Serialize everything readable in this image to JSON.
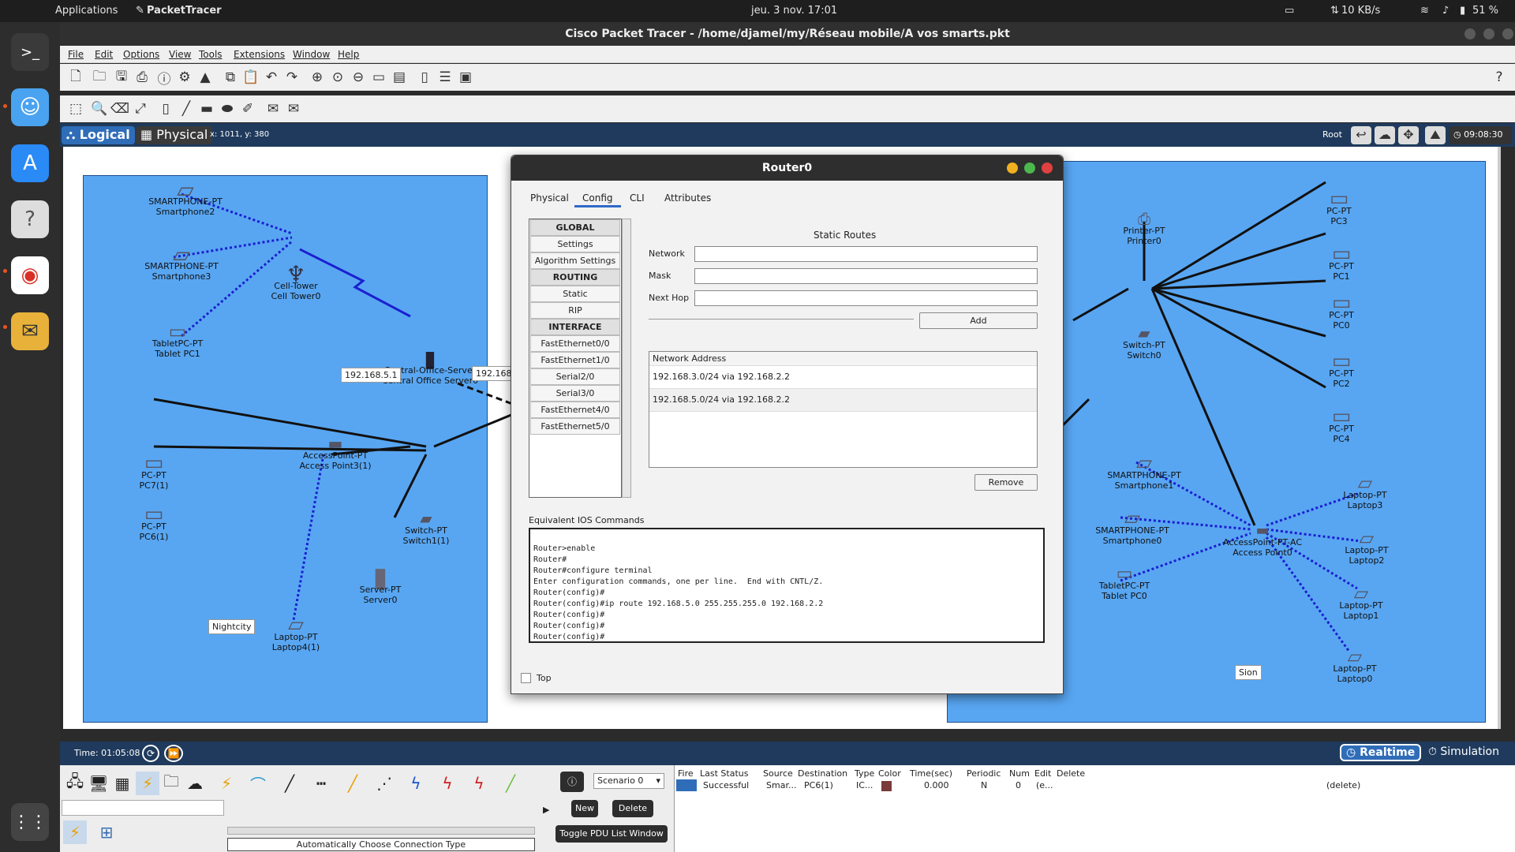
{
  "topbar": {
    "apps": "Applications",
    "active_app": "PacketTracer",
    "clock": "jeu. 3 nov.  17:01",
    "network": "10 KB/s",
    "battery": "51 %"
  },
  "window": {
    "title": "Cisco Packet Tracer - /home/djamel/my/Réseau mobile/A vos smarts.pkt"
  },
  "menu": [
    "File",
    "Edit",
    "Options",
    "View",
    "Tools",
    "Extensions",
    "Window",
    "Help"
  ],
  "logicbar": {
    "logical": "Logical",
    "physical": "Physical",
    "coords": "x: 1011, y: 380",
    "root": "Root",
    "time": "09:08:30"
  },
  "devices": {
    "smartphone2": [
      "SMARTPHONE-PT",
      "Smartphone2"
    ],
    "smartphone3": [
      "SMARTPHONE-PT",
      "Smartphone3"
    ],
    "celltower": [
      "Cell-Tower",
      "Cell Tower0"
    ],
    "tablet1": [
      "TabletPC-PT",
      "Tablet PC1"
    ],
    "co_server": [
      "Central-Office-Server",
      "Central Office Server0"
    ],
    "accesspoint3": [
      "AccessPoint-PT",
      "Access Point3(1)"
    ],
    "pc7": [
      "PC-PT",
      "PC7(1)"
    ],
    "pc6": [
      "PC-PT",
      "PC6(1)"
    ],
    "switch1": [
      "Switch-PT",
      "Switch1(1)"
    ],
    "server0": [
      "Server-PT",
      "Server0"
    ],
    "laptop4": [
      "Laptop-PT",
      "Laptop4(1)"
    ],
    "printer0": [
      "Printer-PT",
      "Printer0"
    ],
    "pc3": [
      "PC-PT",
      "PC3"
    ],
    "pc1": [
      "PC-PT",
      "PC1"
    ],
    "pc0": [
      "PC-PT",
      "PC0"
    ],
    "pc2": [
      "PC-PT",
      "PC2"
    ],
    "pc4": [
      "PC-PT",
      "PC4"
    ],
    "switch0": [
      "Switch-PT",
      "Switch0"
    ],
    "smartphone1": [
      "SMARTPHONE-PT",
      "Smartphone1"
    ],
    "smartphone0": [
      "SMARTPHONE-PT",
      "Smartphone0"
    ],
    "tablet0": [
      "TabletPC-PT",
      "Tablet PC0"
    ],
    "accesspoint0": [
      "AccessPoint-PT-AC",
      "Access Point0"
    ],
    "laptop3": [
      "Laptop-PT",
      "Laptop3"
    ],
    "laptop2": [
      "Laptop-PT",
      "Laptop2"
    ],
    "laptop1": [
      "Laptop-PT",
      "Laptop1"
    ],
    "laptop0": [
      "Laptop-PT",
      "Laptop0"
    ]
  },
  "labels": {
    "ip1": "192.168.5.1",
    "ip2": "192.168",
    "nightcity": "Nightcity",
    "sion": "Sion"
  },
  "dialog": {
    "title": "Router0",
    "tabs": [
      "Physical",
      "Config",
      "CLI",
      "Attributes"
    ],
    "nav": [
      "GLOBAL",
      "Settings",
      "Algorithm Settings",
      "ROUTING",
      "Static",
      "RIP",
      "INTERFACE",
      "FastEthernet0/0",
      "FastEthernet1/0",
      "Serial2/0",
      "Serial3/0",
      "FastEthernet4/0",
      "FastEthernet5/0"
    ],
    "section_title": "Static Routes",
    "network_label": "Network",
    "mask_label": "Mask",
    "nexthop_label": "Next Hop",
    "add_label": "Add",
    "table_header": "Network Address",
    "routes": [
      "192.168.3.0/24 via 192.168.2.2",
      "192.168.5.0/24 via 192.168.2.2"
    ],
    "remove_label": "Remove",
    "ios_label": "Equivalent IOS Commands",
    "ios_text": "Router>enable\nRouter#\nRouter#configure terminal\nEnter configuration commands, one per line.  End with CNTL/Z.\nRouter(config)#\nRouter(config)#ip route 192.168.5.0 255.255.255.0 192.168.2.2\nRouter(config)#\nRouter(config)#\nRouter(config)#",
    "top_label": "Top"
  },
  "timebar": {
    "time": "Time: 01:05:08",
    "realtime": "Realtime",
    "simulation": "Simulation"
  },
  "bottom": {
    "conn_type": "Automatically Choose Connection Type",
    "scenario": "Scenario 0",
    "new": "New",
    "delete": "Delete",
    "toggle": "Toggle PDU List Window",
    "pdu_headers": [
      "Fire",
      "Last Status",
      "Source",
      "Destination",
      "Type",
      "Color",
      "Time(sec)",
      "Periodic",
      "Num",
      "Edit",
      "Delete"
    ],
    "pdu_row": [
      "Successful",
      "Smar...",
      "PC6(1)",
      "IC...",
      "0.000",
      "N",
      "0",
      "(e...",
      "(delete)"
    ],
    "pdu_color": "#7a3a3a"
  }
}
